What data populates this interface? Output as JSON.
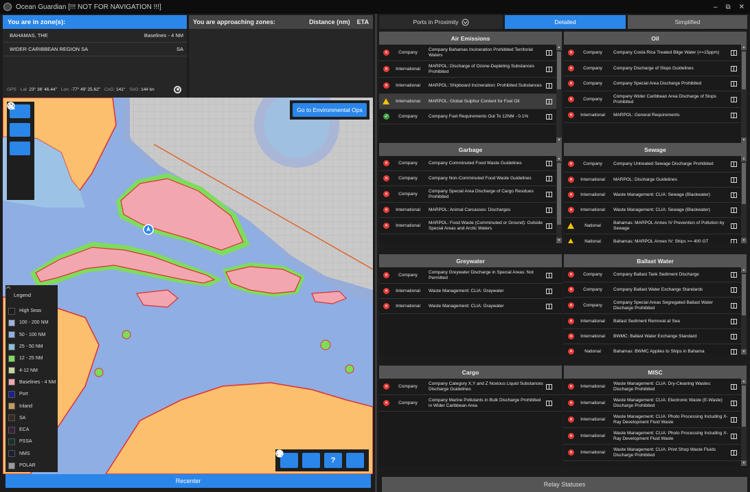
{
  "window": {
    "title": "Ocean Guardian [!!! NOT FOR NAVIGATION !!!]",
    "minimize": "–",
    "restore": "⧉",
    "close": "✕"
  },
  "zones": {
    "header": "You are in zone(s):",
    "rows": [
      {
        "name": "BAHAMAS, THE",
        "type": "Baselines - 4 NM"
      },
      {
        "name": "WIDER CARIBBEAN REGION SA",
        "type": "SA"
      }
    ]
  },
  "gps": {
    "label": "GPS",
    "lat_label": "Lat:",
    "lat": "23° 36' 46.44\"",
    "lon_label": "Lon:",
    "lon": "-77° 49' 25.62\"",
    "cog_label": "CoG:",
    "cog": "141°",
    "sog_label": "SoG:",
    "sog": "144 kn"
  },
  "approaching": {
    "header": "You are approaching zones:",
    "distance": "Distance (nm)",
    "eta": "ETA"
  },
  "map": {
    "tools": [
      "zoom-in",
      "zoom-out",
      "compass",
      "draw",
      "pointer"
    ],
    "env_ops_button": "Go to Environmental Ops",
    "legend_title": "Legend",
    "legend": [
      {
        "label": "High Seas",
        "color": "#1b1b1b"
      },
      {
        "label": "100 - 200 NM",
        "color": "#9fb3d8"
      },
      {
        "label": "50 - 100 NM",
        "color": "#8fb0e2"
      },
      {
        "label": "25 - 50 NM",
        "color": "#86c0d6"
      },
      {
        "label": "12 - 25 NM",
        "color": "#7edc5c"
      },
      {
        "label": "4-12 NM",
        "color": "#c7d79b"
      },
      {
        "label": "Baselines - 4 NM",
        "color": "#f2a7b0"
      },
      {
        "label": "Port",
        "color": "#1d1f8f"
      },
      {
        "label": "Inland",
        "color": "#c69c5a"
      },
      {
        "label": "SA",
        "color": "#3a2a1f"
      },
      {
        "label": "ECA",
        "color": "#3b203b"
      },
      {
        "label": "PSSA",
        "color": "#16332a"
      },
      {
        "label": "NMS",
        "color": "#1a1f33"
      },
      {
        "label": "POLAR",
        "color": "#9a9a9a"
      }
    ],
    "action_buttons": [
      "settings",
      "lightbulb",
      "help",
      "globe"
    ],
    "help_glyph": "?",
    "recenter": "Recenter"
  },
  "panel": {
    "tabs": {
      "ports": "Ports in Proximity",
      "detailed": "Detailed",
      "simplified": "Simplified"
    },
    "relay": "Relay Statuses",
    "colors": {
      "accent": "#2b86e9",
      "danger": "#e53935",
      "warning": "#f2c200",
      "ok": "#43a047"
    }
  },
  "sections": {
    "air": {
      "title": "Air Emissions",
      "rows": [
        {
          "status": "x",
          "source": "Company",
          "text": "Company Bahamas Incineration Prohibited Territorial Waters"
        },
        {
          "status": "x",
          "source": "International",
          "text": "MARPOL: Discharge of Ozone-Depleting Substances Prohibited"
        },
        {
          "status": "x",
          "source": "International",
          "text": "MARPOL: Shipboard Incineration: Prohibited Substances"
        },
        {
          "status": "w",
          "source": "International",
          "text": "MARPOL: Global Sulphur Content for Fuel Oil"
        },
        {
          "status": "ok",
          "source": "Company",
          "text": "Company Fuel Requirements Out To 12NM - 0.1%"
        }
      ]
    },
    "oil": {
      "title": "Oil",
      "rows": [
        {
          "status": "x",
          "source": "Company",
          "text": "Company Costa Rica Treated Bilge Water (<=15ppm)"
        },
        {
          "status": "x",
          "source": "Company",
          "text": "Company Discharge of Slops Guidelines"
        },
        {
          "status": "x",
          "source": "Company",
          "text": "Company Special Area Discharge Prohibited"
        },
        {
          "status": "x",
          "source": "Company",
          "text": "Company Wider Caribbean Area Discharge of Slops Prohibited"
        },
        {
          "status": "x",
          "source": "International",
          "text": "MARPOL: General Requirements"
        }
      ]
    },
    "garbage": {
      "title": "Garbage",
      "rows": [
        {
          "status": "x",
          "source": "Company",
          "text": "Company Comminuted Food Waste Guidelines"
        },
        {
          "status": "x",
          "source": "Company",
          "text": "Company Non-Comminuted Food Waste Guidelines"
        },
        {
          "status": "x",
          "source": "Company",
          "text": "Company Special Area Discharge of Cargo Residues Prohibited"
        },
        {
          "status": "x",
          "source": "International",
          "text": "MARPOL: Animal Carcasses: Discharges"
        },
        {
          "status": "x",
          "source": "International",
          "text": "MARPOL: Food Waste (Comminuted or Ground): Outside Special Areas and Arctic Waters"
        }
      ]
    },
    "sewage": {
      "title": "Sewage",
      "rows": [
        {
          "status": "x",
          "source": "Company",
          "text": "Company Untreated Sewage Discharge Prohibited"
        },
        {
          "status": "x",
          "source": "International",
          "text": "MARPOL: Discharge Guidelines"
        },
        {
          "status": "x",
          "source": "International",
          "text": "Waste Management: CLIA: Sewage (Blackwater)"
        },
        {
          "status": "x",
          "source": "International",
          "text": "Waste Management: CLIA: Sewage (Blackwater)"
        },
        {
          "status": "w",
          "source": "National",
          "text": "Bahamas: MARPOL Annex IV Prevention of Pollution by Sewage"
        },
        {
          "status": "w",
          "source": "National",
          "text": "Bahamas: MARPOL Annex IV: Ships >= 400 GT"
        }
      ]
    },
    "grey": {
      "title": "Greywater",
      "rows": [
        {
          "status": "x",
          "source": "Company",
          "text": "Company Greywater Discharge in Special Areas: Not Permitted"
        },
        {
          "status": "x",
          "source": "International",
          "text": "Waste Management: CLIA: Graywater"
        },
        {
          "status": "x",
          "source": "International",
          "text": "Waste Management: CLIA: Graywater"
        }
      ]
    },
    "ballast": {
      "title": "Ballast Water",
      "rows": [
        {
          "status": "x",
          "source": "Company",
          "text": "Company Ballast Tank Sediment Discharge"
        },
        {
          "status": "x",
          "source": "Company",
          "text": "Company Ballast Water Exchange Standards"
        },
        {
          "status": "x",
          "source": "Company",
          "text": "Company Special Areas Segregated Ballast Water Discharge Prohibited"
        },
        {
          "status": "x",
          "source": "International",
          "text": "Ballast Sediment Removal at Sea"
        },
        {
          "status": "x",
          "source": "International",
          "text": "BWMC: Ballast Water Exchange Standard"
        },
        {
          "status": "x",
          "source": "National",
          "text": "Bahamas: BWMC Applies to Ships in Bahama"
        }
      ]
    },
    "cargo": {
      "title": "Cargo",
      "rows": [
        {
          "status": "x",
          "source": "Company",
          "text": "Company Category X,Y and Z Noxious Liquid Substances Discharge Guidelines"
        },
        {
          "status": "x",
          "source": "Company",
          "text": "Company Marine Pollutants in Bulk Discharge Prohibited in Wider Caribbean Area"
        }
      ]
    },
    "misc": {
      "title": "MISC",
      "rows": [
        {
          "status": "x",
          "source": "International",
          "text": "Waste Management: CLIA: Dry-Cleaning Wastes: Discharge Prohibited"
        },
        {
          "status": "x",
          "source": "International",
          "text": "Waste Management: CLIA: Electronic Waste (E-Waste) Discharge Prohibited"
        },
        {
          "status": "x",
          "source": "International",
          "text": "Waste Management: CLIA: Photo Processing Including X-Ray Development Fluid Waste"
        },
        {
          "status": "x",
          "source": "International",
          "text": "Waste Management: CLIA: Photo Processing Including X-Ray Development Fluid Waste"
        },
        {
          "status": "x",
          "source": "International",
          "text": "Waste Management: CLIA: Print Shop Waste Fluids Discharge Prohibited"
        }
      ]
    }
  }
}
